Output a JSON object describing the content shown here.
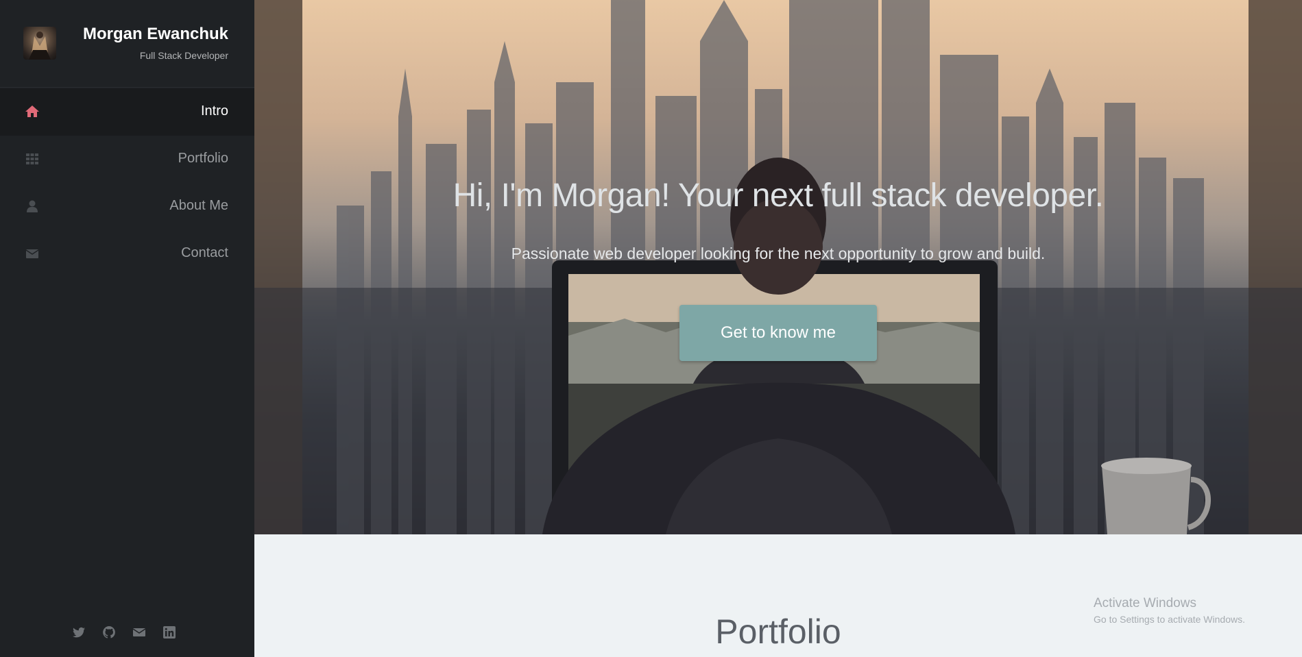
{
  "profile": {
    "name": "Morgan Ewanchuk",
    "role": "Full Stack Developer"
  },
  "nav": {
    "items": [
      {
        "label": "Intro",
        "icon": "home-icon",
        "active": true
      },
      {
        "label": "Portfolio",
        "icon": "grid-icon",
        "active": false
      },
      {
        "label": "About Me",
        "icon": "user-icon",
        "active": false
      },
      {
        "label": "Contact",
        "icon": "envelope-icon",
        "active": false
      }
    ]
  },
  "social": [
    "twitter-icon",
    "github-icon",
    "email-icon",
    "linkedin-icon"
  ],
  "hero": {
    "title": "Hi, I'm Morgan! Your next full stack developer.",
    "subtitle": "Passionate web developer looking for the next opportunity to grow and build.",
    "button_label": "Get to know me"
  },
  "portfolio": {
    "title": "Portfolio"
  },
  "watermark": {
    "title": "Activate Windows",
    "subtitle": "Go to Settings to activate Windows."
  },
  "colors": {
    "sidebar_bg": "#1f2225",
    "active_icon": "#e06a78",
    "button_bg": "#7ea7a6",
    "section_bg": "#eef2f4"
  }
}
